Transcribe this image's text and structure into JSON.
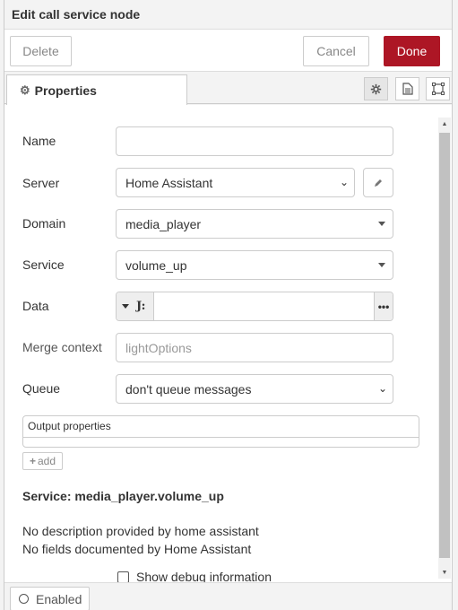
{
  "tray": {
    "title": "Edit call service node"
  },
  "toolbar": {
    "delete_label": "Delete",
    "cancel_label": "Cancel",
    "done_label": "Done"
  },
  "tabs": {
    "properties_label": "Properties"
  },
  "form": {
    "name_label": "Name",
    "name_value": "",
    "server_label": "Server",
    "server_value": "Home Assistant",
    "domain_label": "Domain",
    "domain_value": "media_player",
    "service_label": "Service",
    "service_value": "volume_up",
    "data_label": "Data",
    "data_type_icon": "J:",
    "data_more": "•••",
    "merge_label": "Merge context",
    "merge_placeholder": "lightOptions",
    "queue_label": "Queue",
    "queue_value": "don't queue messages"
  },
  "output": {
    "header": "Output properties",
    "add_label": "add"
  },
  "service_info": {
    "title": "Service: media_player.volume_up",
    "desc1": "No description provided by home assistant",
    "desc2": "No fields documented by Home Assistant"
  },
  "debug": {
    "label": "Show debug information"
  },
  "footer": {
    "enabled_label": "Enabled"
  },
  "colors": {
    "done": "#ad1625",
    "accent_border": "#cccccc"
  }
}
